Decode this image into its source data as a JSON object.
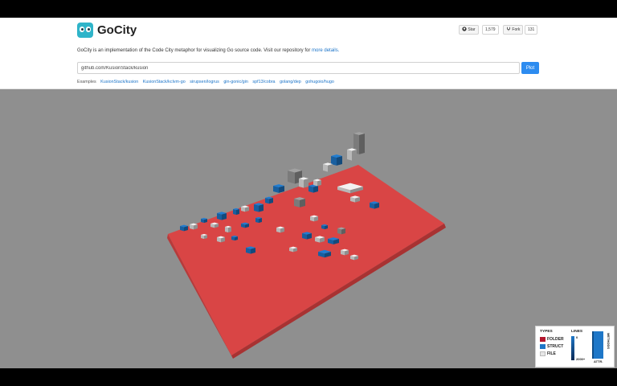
{
  "header": {
    "brand": "GoCity",
    "star_label": "Star",
    "star_count": "1,579",
    "fork_label": "Fork",
    "fork_count": "131",
    "description_text": "GoCity is an implementation of the Code City metaphor for visualizing Go source code. Visit our repository for",
    "description_link": "more details.",
    "repo_input_value": "github.com/KusionStack/kusion",
    "plot_label": "Plot",
    "examples_label": "Examples",
    "examples": [
      "KusionStack/kusion",
      "KusionStack/kclvm-go",
      "sirupsen/logrus",
      "gin-gonic/gin",
      "spf13/cobra",
      "golang/dep",
      "gohugoio/hugo"
    ]
  },
  "legend": {
    "types_title": "TYPES",
    "lines_title": "LINES",
    "folder_label": "FOLDER",
    "struct_label": "STRUCT",
    "file_label": "FILE",
    "lines_min": "0",
    "lines_max": "2000+",
    "attr_label": "ATTR.",
    "methods_label": "METHODS"
  },
  "colors": {
    "folder": "#b3172e",
    "struct": "#1e77c8",
    "file": "#e6e6e6",
    "ground": "#e04a4a",
    "accent": "#2d8cf0"
  }
}
